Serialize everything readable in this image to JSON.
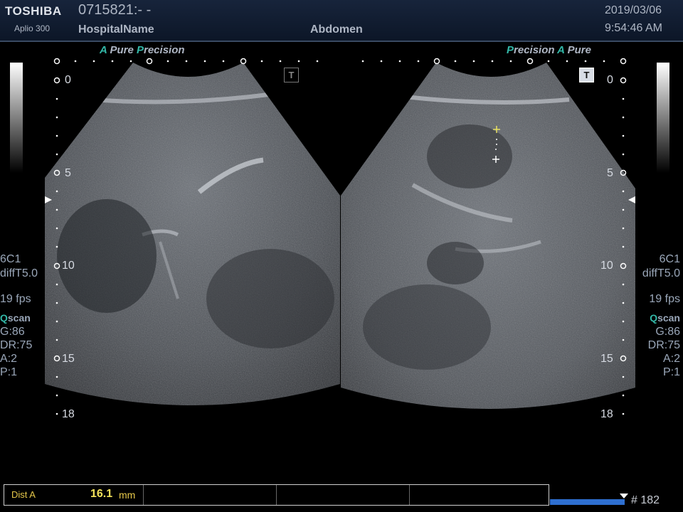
{
  "header": {
    "brand": "TOSHIBA",
    "model": "Aplio 300",
    "patient_id": "0715821:- -",
    "hospital": "HospitalName",
    "exam": "Abdomen",
    "date": "2019/03/06",
    "time": "9:54:46 AM"
  },
  "left_image": {
    "mode_a_letter": "A",
    "mode_pure": "Pure",
    "mode_p_letter": "P",
    "mode_precision_rest": "recision",
    "probe": "6C1",
    "preset": "diffT5.0",
    "fps": "19 fps",
    "qscan_q": "Q",
    "qscan_rest": "scan",
    "gain": "G:86",
    "dr": "DR:75",
    "a": "A:2",
    "p": "P:1",
    "depth_labels": [
      "0",
      "5",
      "10",
      "15",
      "18"
    ],
    "trapezoid_icon_letter": "T"
  },
  "right_image": {
    "mode_p_letter": "P",
    "mode_precision_rest": "recision",
    "mode_a_letter": "A",
    "mode_pure": "Pure",
    "probe": "6C1",
    "preset": "diffT5.0",
    "fps": "19 fps",
    "qscan_q": "Q",
    "qscan_rest": "scan",
    "gain": "G:86",
    "dr": "DR:75",
    "a": "A:2",
    "p": "P:1",
    "depth_labels": [
      "0",
      "5",
      "10",
      "15",
      "18"
    ],
    "trapezoid_icon_letter": "T"
  },
  "measurement": {
    "label": "Dist A",
    "value": "16.1",
    "unit": "mm"
  },
  "cine": {
    "frame": "# 182"
  },
  "colors": {
    "header_bg": "#17243b",
    "accent_teal": "#33b8a8",
    "measurement_yellow": "#f3e15a",
    "cine_blue": "#2e6fd0",
    "caliper_yellow": "#e8e060"
  }
}
